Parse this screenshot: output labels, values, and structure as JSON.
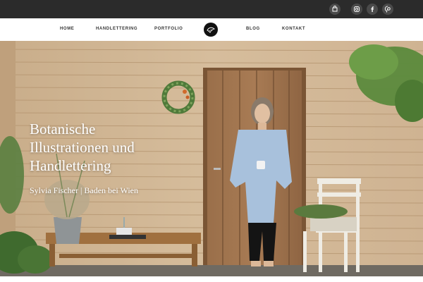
{
  "topbar": {
    "icons": [
      "bag-icon",
      "instagram-icon",
      "facebook-icon",
      "pinterest-icon"
    ],
    "bg_color": "#2b2b2b"
  },
  "nav": {
    "items": [
      "HOME",
      "HANDLETTERING",
      "PORTFOLIO",
      "BLOG",
      "KONTAKT"
    ],
    "logo_icon": "round-logo-icon"
  },
  "hero": {
    "title_lines": [
      "Botanische",
      "Illustrationen und",
      "Handlettering"
    ],
    "subtitle": "Sylvia Fischer | Baden bei Wien"
  }
}
